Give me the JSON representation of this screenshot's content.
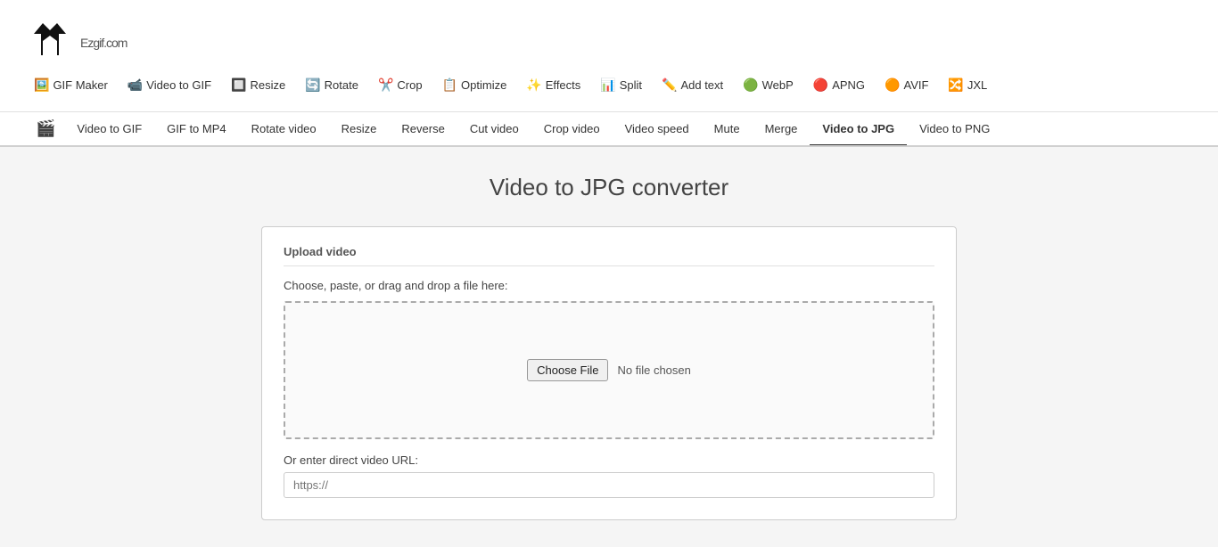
{
  "logo": {
    "text": "Ezgif",
    "suffix": ".com"
  },
  "top_nav": {
    "items": [
      {
        "label": "GIF Maker",
        "icon": "🖼️",
        "name": "gif-maker"
      },
      {
        "label": "Video to GIF",
        "icon": "📹",
        "name": "video-to-gif"
      },
      {
        "label": "Resize",
        "icon": "🔲",
        "name": "resize"
      },
      {
        "label": "Rotate",
        "icon": "🔄",
        "name": "rotate"
      },
      {
        "label": "Crop",
        "icon": "✂️",
        "name": "crop"
      },
      {
        "label": "Optimize",
        "icon": "📋",
        "name": "optimize"
      },
      {
        "label": "Effects",
        "icon": "✨",
        "name": "effects"
      },
      {
        "label": "Split",
        "icon": "📊",
        "name": "split"
      },
      {
        "label": "Add text",
        "icon": "✏️",
        "name": "add-text"
      },
      {
        "label": "WebP",
        "icon": "🟢",
        "name": "webp"
      },
      {
        "label": "APNG",
        "icon": "🔴",
        "name": "apng"
      },
      {
        "label": "AVIF",
        "icon": "🟠",
        "name": "avif"
      },
      {
        "label": "JXL",
        "icon": "🔀",
        "name": "jxl"
      }
    ]
  },
  "sub_nav": {
    "items": [
      {
        "label": "Video to GIF",
        "name": "sub-video-to-gif",
        "active": false
      },
      {
        "label": "GIF to MP4",
        "name": "sub-gif-to-mp4",
        "active": false
      },
      {
        "label": "Rotate video",
        "name": "sub-rotate-video",
        "active": false
      },
      {
        "label": "Resize",
        "name": "sub-resize",
        "active": false
      },
      {
        "label": "Reverse",
        "name": "sub-reverse",
        "active": false
      },
      {
        "label": "Cut video",
        "name": "sub-cut-video",
        "active": false
      },
      {
        "label": "Crop video",
        "name": "sub-crop-video",
        "active": false
      },
      {
        "label": "Video speed",
        "name": "sub-video-speed",
        "active": false
      },
      {
        "label": "Mute",
        "name": "sub-mute",
        "active": false
      },
      {
        "label": "Merge",
        "name": "sub-merge",
        "active": false
      },
      {
        "label": "Video to JPG",
        "name": "sub-video-to-jpg",
        "active": true
      },
      {
        "label": "Video to PNG",
        "name": "sub-video-to-png",
        "active": false
      }
    ]
  },
  "page": {
    "title": "Video to JPG converter"
  },
  "upload_section": {
    "box_title": "Upload video",
    "instruction": "Choose, paste, or drag and drop a file here:",
    "choose_file_label": "Choose File",
    "no_file_text": "No file chosen",
    "url_label": "Or enter direct video URL:",
    "url_placeholder": "https://"
  }
}
